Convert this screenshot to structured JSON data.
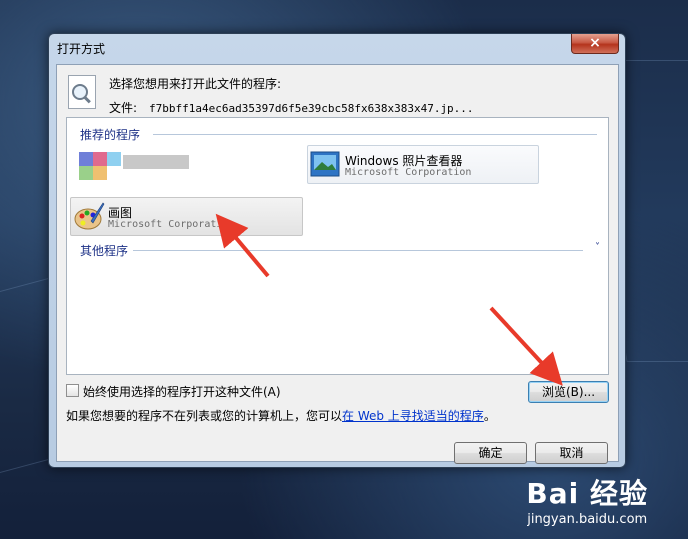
{
  "window": {
    "title": "打开方式",
    "close_label": "×"
  },
  "header": {
    "prompt": "选择您想用来打开此文件的程序:",
    "file_label": "文件:",
    "file_name": "f7bbff1a4ec6ad35397d6f5e39cbc58fx638x383x47.jp..."
  },
  "recommended": {
    "label": "推荐的程序",
    "items": [
      {
        "name": "Windows 照片查看器",
        "publisher": "Microsoft Corporation"
      },
      {
        "name": "画图",
        "publisher": "Microsoft Corporation"
      }
    ]
  },
  "other": {
    "label": "其他程序"
  },
  "always_use": {
    "label": "始终使用选择的程序打开这种文件(A)",
    "checked": false
  },
  "hint": {
    "prefix": "如果您想要的程序不在列表或您的计算机上，您可以",
    "link": "在 Web 上寻找适当的程序",
    "suffix": "。"
  },
  "buttons": {
    "browse": "浏览(B)...",
    "ok": "确定",
    "cancel": "取消"
  },
  "watermark": {
    "brand": "Bai 经验",
    "url": "jingyan.baidu.com"
  }
}
